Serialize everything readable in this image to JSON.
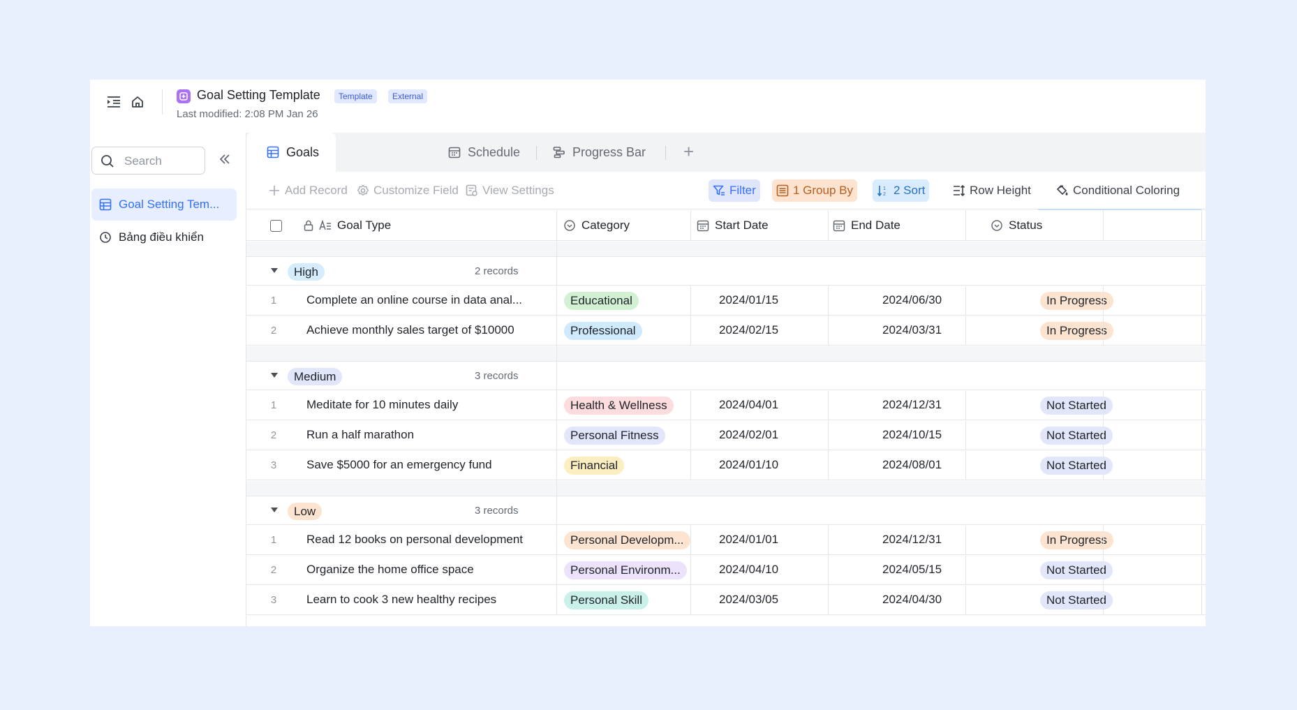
{
  "header": {
    "title": "Goal Setting Template",
    "badges": [
      "Template",
      "External"
    ],
    "subtitle": "Last modified: 2:08 PM Jan 26"
  },
  "sidebar": {
    "search_placeholder": "Search",
    "items": [
      {
        "label": "Goal Setting Tem...",
        "icon": "grid-table-icon",
        "active": true
      },
      {
        "label": "Bảng điều khiển",
        "icon": "dashboard-clock-icon",
        "active": false
      }
    ]
  },
  "tabs": [
    {
      "label": "Goals",
      "icon": "grid-table-icon",
      "active": true
    },
    {
      "label": "Schedule",
      "icon": "calendar-icon",
      "active": false
    },
    {
      "label": "Progress Bar",
      "icon": "gantt-icon",
      "active": false
    }
  ],
  "toolbar": {
    "add_record": "Add Record",
    "customize_field": "Customize Field",
    "view_settings": "View Settings",
    "filter": "Filter",
    "group_by": "1 Group By",
    "sort": "2 Sort",
    "row_height": "Row Height",
    "conditional_coloring": "Conditional Coloring"
  },
  "columns": [
    "Goal Type",
    "Category",
    "Start Date",
    "End Date",
    "Status"
  ],
  "colors": {
    "accent": "#3370ff",
    "high": "#d4ecfb",
    "medium": "#e1e6fb",
    "low": "#fde4d0"
  },
  "groups": [
    {
      "name": "High",
      "count": "2 records",
      "rows": [
        {
          "num": "1",
          "goal": "Complete an online course in data anal...",
          "category": "Educational",
          "start": "2024/01/15",
          "end": "2024/06/30",
          "status": "In Progress"
        },
        {
          "num": "2",
          "goal": "Achieve monthly sales target of $10000",
          "category": "Professional",
          "start": "2024/02/15",
          "end": "2024/03/31",
          "status": "In Progress"
        }
      ]
    },
    {
      "name": "Medium",
      "count": "3 records",
      "rows": [
        {
          "num": "1",
          "goal": "Meditate for 10 minutes daily",
          "category": "Health & Wellness",
          "start": "2024/04/01",
          "end": "2024/12/31",
          "status": "Not Started"
        },
        {
          "num": "2",
          "goal": "Run a half marathon",
          "category": "Personal Fitness",
          "start": "2024/02/01",
          "end": "2024/10/15",
          "status": "Not Started"
        },
        {
          "num": "3",
          "goal": "Save $5000 for an emergency fund",
          "category": "Financial",
          "start": "2024/01/10",
          "end": "2024/08/01",
          "status": "Not Started"
        }
      ]
    },
    {
      "name": "Low",
      "count": "3 records",
      "rows": [
        {
          "num": "1",
          "goal": "Read 12 books on personal development",
          "category": "Personal Developm...",
          "start": "2024/01/01",
          "end": "2024/12/31",
          "status": "In Progress"
        },
        {
          "num": "2",
          "goal": "Organize the home office space",
          "category": "Personal Environm...",
          "start": "2024/04/10",
          "end": "2024/05/15",
          "status": "Not Started"
        },
        {
          "num": "3",
          "goal": "Learn to cook 3 new healthy recipes",
          "category": "Personal Skill",
          "start": "2024/03/05",
          "end": "2024/04/30",
          "status": "Not Started"
        }
      ]
    }
  ]
}
